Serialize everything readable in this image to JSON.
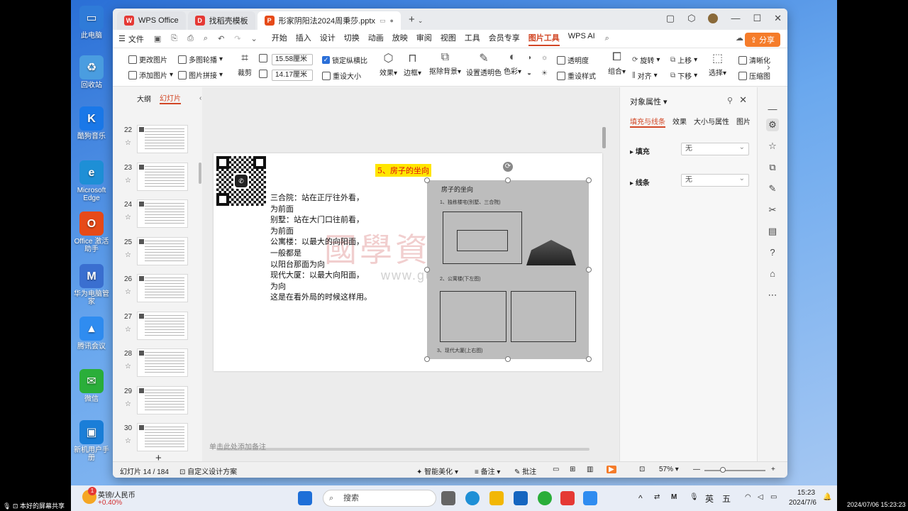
{
  "desktop": {
    "icons": [
      {
        "label": "此电脑",
        "color": "#2f7bd8",
        "glyph": "▭"
      },
      {
        "label": "回收站",
        "color": "#4a9de0",
        "glyph": "♻"
      },
      {
        "label": "酷狗音乐",
        "color": "#1a78e8",
        "glyph": "K"
      },
      {
        "label": "Microsoft Edge",
        "color": "#1e8fd6",
        "glyph": "e"
      },
      {
        "label": "Office 激活助手",
        "color": "#e64a19",
        "glyph": "O"
      },
      {
        "label": "华为电脑管家",
        "color": "#3a6fd0",
        "glyph": "M"
      },
      {
        "label": "腾讯会议",
        "color": "#2f8cf0",
        "glyph": "▲"
      },
      {
        "label": "微信",
        "color": "#2aae3a",
        "glyph": "✉"
      },
      {
        "label": "新机用户手册",
        "color": "#1a7ed8",
        "glyph": "▣"
      }
    ]
  },
  "titlebar": {
    "tabs": [
      {
        "label": "WPS Office",
        "color": "#e53935",
        "glyph": "W"
      },
      {
        "label": "找稻壳模板",
        "color": "#e53935",
        "glyph": "D"
      },
      {
        "label": "形家阴阳法2024周秉莎.pptx",
        "color": "#e64a19",
        "glyph": "P"
      }
    ],
    "new_tab": "+",
    "controls": [
      "▢",
      "⬡",
      "—",
      "☐",
      "✕"
    ]
  },
  "menubar": {
    "file": "文件",
    "items": [
      "开始",
      "插入",
      "设计",
      "切换",
      "动画",
      "放映",
      "审阅",
      "视图",
      "工具",
      "会员专享",
      "图片工具",
      "WPS AI"
    ],
    "active": "图片工具",
    "share": "分享"
  },
  "ribbon": {
    "change_picture": "更改图片",
    "multi_carousel": "多图轮播",
    "add_picture": "添加图片",
    "picture_stitch": "图片拼接",
    "crop": "裁剪",
    "width": "15.58厘米",
    "height": "14.17厘米",
    "lock_ratio": "锁定纵横比",
    "reset_size": "重设大小",
    "effects": "效果",
    "border": "边框",
    "remove_bg": "抠除背景",
    "set_transparent": "设置透明色",
    "color": "色彩",
    "transparency": "透明度",
    "reset_style": "重设样式",
    "group": "组合",
    "rotate": "旋转",
    "align": "对齐",
    "move_up": "上移",
    "move_down": "下移",
    "select": "选择",
    "sharpen": "清晰化",
    "compress": "压缩图"
  },
  "leftpane": {
    "tab_outline": "大纲",
    "tab_slides": "幻灯片",
    "slides": [
      "22",
      "23",
      "24",
      "25",
      "26",
      "27",
      "28",
      "29",
      "30"
    ],
    "add": "+"
  },
  "slide": {
    "title": "5、房子的坐向",
    "body_lines": [
      "三合院：站在正厅往外看，",
      "为前面",
      "别墅：站在大门口往前看，",
      "为前面",
      "公寓楼：以最大的向阳面，",
      "一般都是",
      "以阳台那面为向",
      "现代大厦：以最大向阳面，",
      "为向",
      "这是在看外局的时候这样用。"
    ],
    "qr_center": "✆",
    "photo_title": "房子的坐向",
    "photo_sub1": "1、独栋楼宅(别墅、三合院)",
    "photo_sub2": "2、公寓楼(下左图)",
    "photo_sub3": "3、现代大厦(上右图)",
    "watermark": "國學資源網",
    "watermark_url": "www.guoxueziyuan.com",
    "notes_placeholder": "单击此处添加备注"
  },
  "rightpane": {
    "title": "对象属性",
    "tabs": [
      "填充与线条",
      "效果",
      "大小与属性",
      "图片"
    ],
    "fill_label": "填充",
    "fill_value": "无",
    "line_label": "线条",
    "line_value": "无"
  },
  "statusbar": {
    "slide_count": "幻灯片 14 / 184",
    "custom_design": "自定义设计方案",
    "smart_beautify": "智能美化",
    "notes": "备注",
    "comments": "批注",
    "zoom": "57%"
  },
  "taskbar": {
    "weather_title": "英镑/人民币",
    "weather_value": "+0.40%",
    "badge": "1",
    "search": "搜索",
    "ime1": "英",
    "ime2": "五",
    "time": "15:23",
    "date": "2024/7/6"
  },
  "overlay": {
    "left_caption": "本好的屏幕共享",
    "right_timestamp": "2024/07/06 15:23:23"
  }
}
